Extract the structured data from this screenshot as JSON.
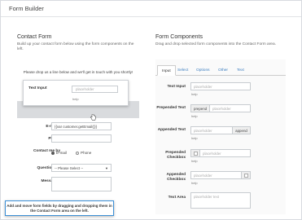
{
  "app": {
    "title": "Form Builder"
  },
  "contact_form": {
    "heading": "Contact Form",
    "subtitle": "Build up your contact form below using the form components on the left.",
    "message": "Please drop us a line below and we'll get in touch with you shortly!",
    "dragging": {
      "label": "Text Input",
      "placeholder": "placeholder",
      "help": "help"
    },
    "fields": {
      "email": {
        "label": "E-mail",
        "required_mark": "*",
        "value": "{{var customer.getEmail()}}"
      },
      "phone": {
        "label": "Phone",
        "value": ""
      },
      "contact_me_by": {
        "label": "Contact me by",
        "options": [
          "E-mail",
          "Phone"
        ],
        "selected": "E-mail"
      },
      "question_for": {
        "label": "Question for",
        "selected": "-- Please Select --"
      },
      "message": {
        "label": "Message",
        "required_mark": "*"
      }
    },
    "tooltip": "Add and move form fields by dragging and dropping them in the Contact Form area on the left."
  },
  "components": {
    "heading": "Form Components",
    "subtitle": "Drag and drop selected form components into the Contact Form area.",
    "tabs": [
      "Input",
      "Select",
      "Options",
      "Other",
      "Text"
    ],
    "active_tab": "Input",
    "items": {
      "text_input": {
        "label": "Text Input",
        "placeholder": "placeholder",
        "help": "help"
      },
      "prepended_text": {
        "label": "Prepended Text",
        "addon": "prepend",
        "placeholder": "placeholder",
        "help": "help"
      },
      "appended_text": {
        "label": "Appended Text",
        "addon": "append",
        "placeholder": "placeholder",
        "help": "help"
      },
      "prepended_checkbox": {
        "label": "Prepended Checkbox",
        "placeholder": "placeholder",
        "help": "help"
      },
      "appended_checkbox": {
        "label": "Appended Checkbox",
        "placeholder": "placeholder",
        "help": "help"
      },
      "text_area": {
        "label": "Text Area",
        "placeholder": "placeholder text"
      }
    }
  },
  "colors": {
    "accent": "#3b8fd6",
    "required": "#c9302c",
    "link": "#3b7dbf"
  }
}
